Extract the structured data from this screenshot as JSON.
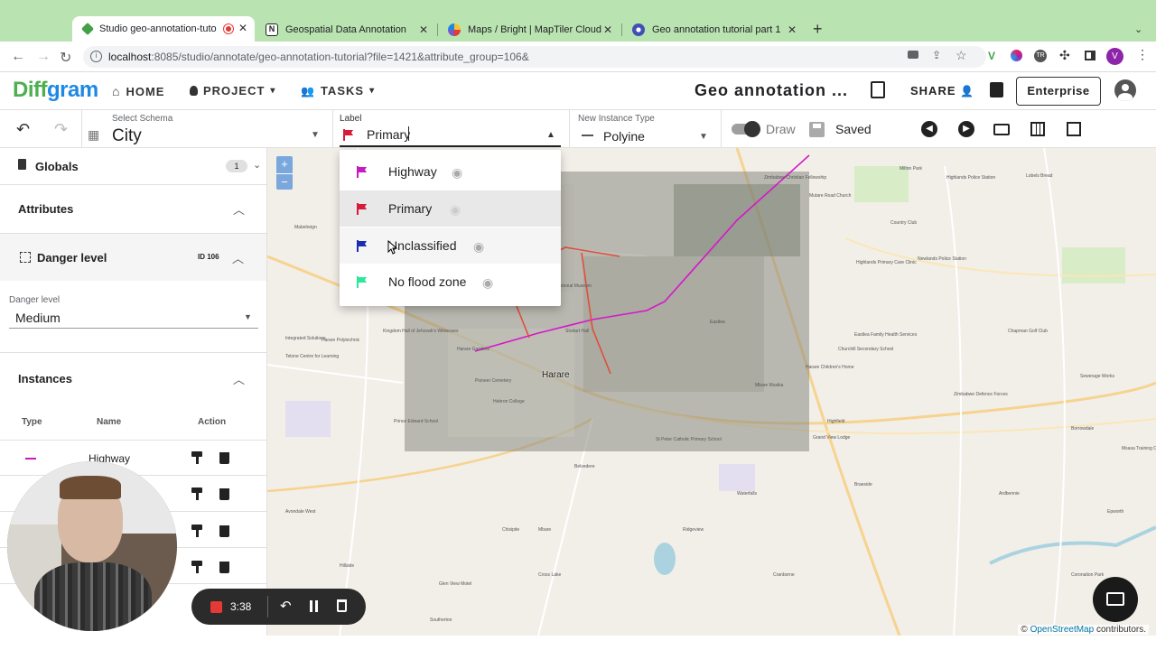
{
  "browser": {
    "tabs": [
      {
        "title": "Studio geo-annotation-tuto",
        "color": "#43a047",
        "active": true
      },
      {
        "title": "Geospatial Data Annotation",
        "color": "#222222",
        "active": false
      },
      {
        "title": "Maps / Bright | MapTiler Cloud",
        "color": "#7e57c2",
        "active": false
      },
      {
        "title": "Geo annotation tutorial part 1",
        "color": "#3f51b5",
        "active": false
      }
    ],
    "url_host": "localhost",
    "url_rest": ":8085/studio/annotate/geo-annotation-tutorial?file=1421&attribute_group=106&",
    "profile_initial": "V"
  },
  "app": {
    "logo_diff": "Diff",
    "logo_gram": "gram",
    "nav": {
      "home": "HOME",
      "project": "PROJECT",
      "tasks": "TASKS"
    },
    "title": "Geo annotation ...",
    "share": "SHARE",
    "enterprise": "Enterprise"
  },
  "toolbar": {
    "schema_label": "Select Schema",
    "schema_value": "City",
    "label_label": "Label",
    "label_value": "Primary",
    "instance_type_label": "New Instance Type",
    "instance_type_value": "Polyine",
    "draw_label": "Draw",
    "saved_label": "Saved"
  },
  "label_dropdown": {
    "items": [
      {
        "name": "Highway",
        "color": "#c51bc1"
      },
      {
        "name": "Primary",
        "color": "#d81b3a",
        "selected": true
      },
      {
        "name": "Unclassified",
        "color": "#1a2fb0"
      },
      {
        "name": "No flood zone",
        "color": "#2ee89a"
      }
    ]
  },
  "left_panel": {
    "globals": {
      "label": "Globals",
      "count": "1"
    },
    "attributes": {
      "label": "Attributes"
    },
    "danger": {
      "label": "Danger level",
      "id": "ID 106",
      "field_label": "Danger level",
      "field_value": "Medium"
    },
    "instances": {
      "label": "Instances",
      "columns": [
        "Type",
        "Name",
        "Action"
      ],
      "rows": [
        {
          "name": "Highway",
          "color": "#c51bc1"
        },
        {
          "name": ""
        },
        {
          "name": ""
        },
        {
          "name": ""
        }
      ]
    }
  },
  "recorder": {
    "time": "3:38"
  },
  "map": {
    "city_label": "Harare",
    "attribution_prefix": "©",
    "attribution_link": "OpenStreetMap",
    "attribution_suffix": "contributors.",
    "zoom_in": "+",
    "zoom_out": "−",
    "labels": [
      "Highlands Police Station",
      "Country Club",
      "Highlands Primary Care Clinic",
      "Eastlea Family Health Services",
      "Churchill Secondary School",
      "Harare Children's Home",
      "Borrowdale",
      "Grand View Lodge",
      "Msasa Training Centre",
      "Epworth",
      "Cranborne",
      "Mbare",
      "Waterfalls",
      "Hatfield Police Station",
      "Zimbabwe Christian Fellowship",
      "Harare Polytechnic",
      "Harare Gardens",
      "National Museum",
      "Pioneer Cemetery",
      "Hebron College",
      "Stodart Hall",
      "Prince Edward School",
      "Telone Centre for Learning",
      "Integrated Solutions",
      "Kingdom Hall of Jehovah's Witnesses",
      "Mutare Road Church",
      "Newlands Police Station",
      "Eastlea",
      "Chapman Golf Club",
      "Laundry Mart",
      "Mabelreign",
      "Belvedere",
      "Avondale West",
      "Milton Park",
      "Lobels Bread",
      "Cross Lake",
      "Sewerage Works",
      "Seke Road",
      "St Peter Catholic Primary School",
      "Glen View Motel",
      "Zimbabwe Defence Forces",
      "Mbare Musika",
      "Ardbennie",
      "Southerton",
      "Braeside",
      "Hillside",
      "Coronation Park",
      "Chisipite",
      "Highfield",
      "Ridgeview"
    ]
  }
}
